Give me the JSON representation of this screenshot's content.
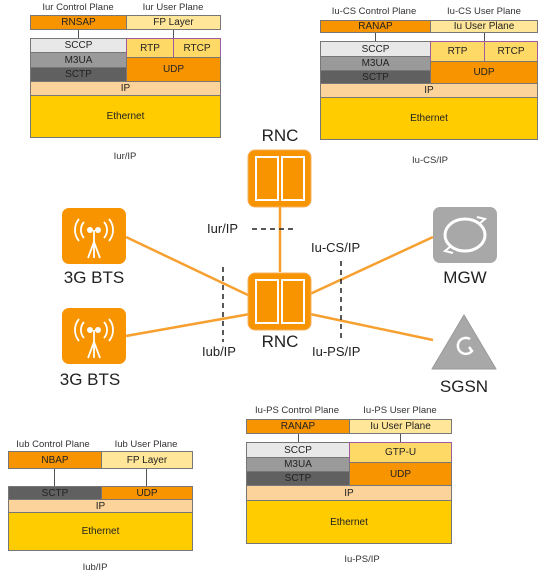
{
  "iur": {
    "control_plane": "Iur Control Plane",
    "user_plane": "Iur User Plane",
    "rnsap": "RNSAP",
    "fp": "FP Layer",
    "sccp": "SCCP",
    "m3ua": "M3UA",
    "sctp": "SCTP",
    "rtp": "RTP",
    "rtcp": "RTCP",
    "udp": "UDP",
    "ip": "IP",
    "ethernet": "Ethernet",
    "caption": "Iur/IP"
  },
  "iucs": {
    "control_plane": "Iu-CS Control Plane",
    "user_plane": "Iu-CS User Plane",
    "ranap": "RANAP",
    "iu_up": "Iu User Plane",
    "sccp": "SCCP",
    "m3ua": "M3UA",
    "sctp": "SCTP",
    "rtp": "RTP",
    "rtcp": "RTCP",
    "udp": "UDP",
    "ip": "IP",
    "ethernet": "Ethernet",
    "caption": "Iu-CS/IP"
  },
  "iub": {
    "control_plane": "Iub Control Plane",
    "user_plane": "Iub User Plane",
    "nbap": "NBAP",
    "fp": "FP Layer",
    "sctp": "SCTP",
    "udp": "UDP",
    "ip": "IP",
    "ethernet": "Ethernet",
    "caption": "Iub/IP"
  },
  "iups": {
    "control_plane": "Iu-PS Control Plane",
    "user_plane": "Iu-PS User Plane",
    "ranap": "RANAP",
    "iu_up": "Iu User Plane",
    "sccp": "SCCP",
    "m3ua": "M3UA",
    "sctp": "SCTP",
    "gtpu": "GTP-U",
    "udp": "UDP",
    "ip": "IP",
    "ethernet": "Ethernet",
    "caption": "Iu-PS/IP"
  },
  "network": {
    "rnc_top": "RNC",
    "rnc_bottom": "RNC",
    "bts1": "3G BTS",
    "bts2": "3G BTS",
    "mgw": "MGW",
    "sgsn": "SGSN",
    "iur_if": "Iur/IP",
    "iub_if": "Iub/IP",
    "iucs_if": "Iu-CS/IP",
    "iups_if": "Iu-PS/IP"
  },
  "colors": {
    "orange": "#f79400",
    "link": "#f7a030",
    "gray_node": "#a8a8a8"
  }
}
